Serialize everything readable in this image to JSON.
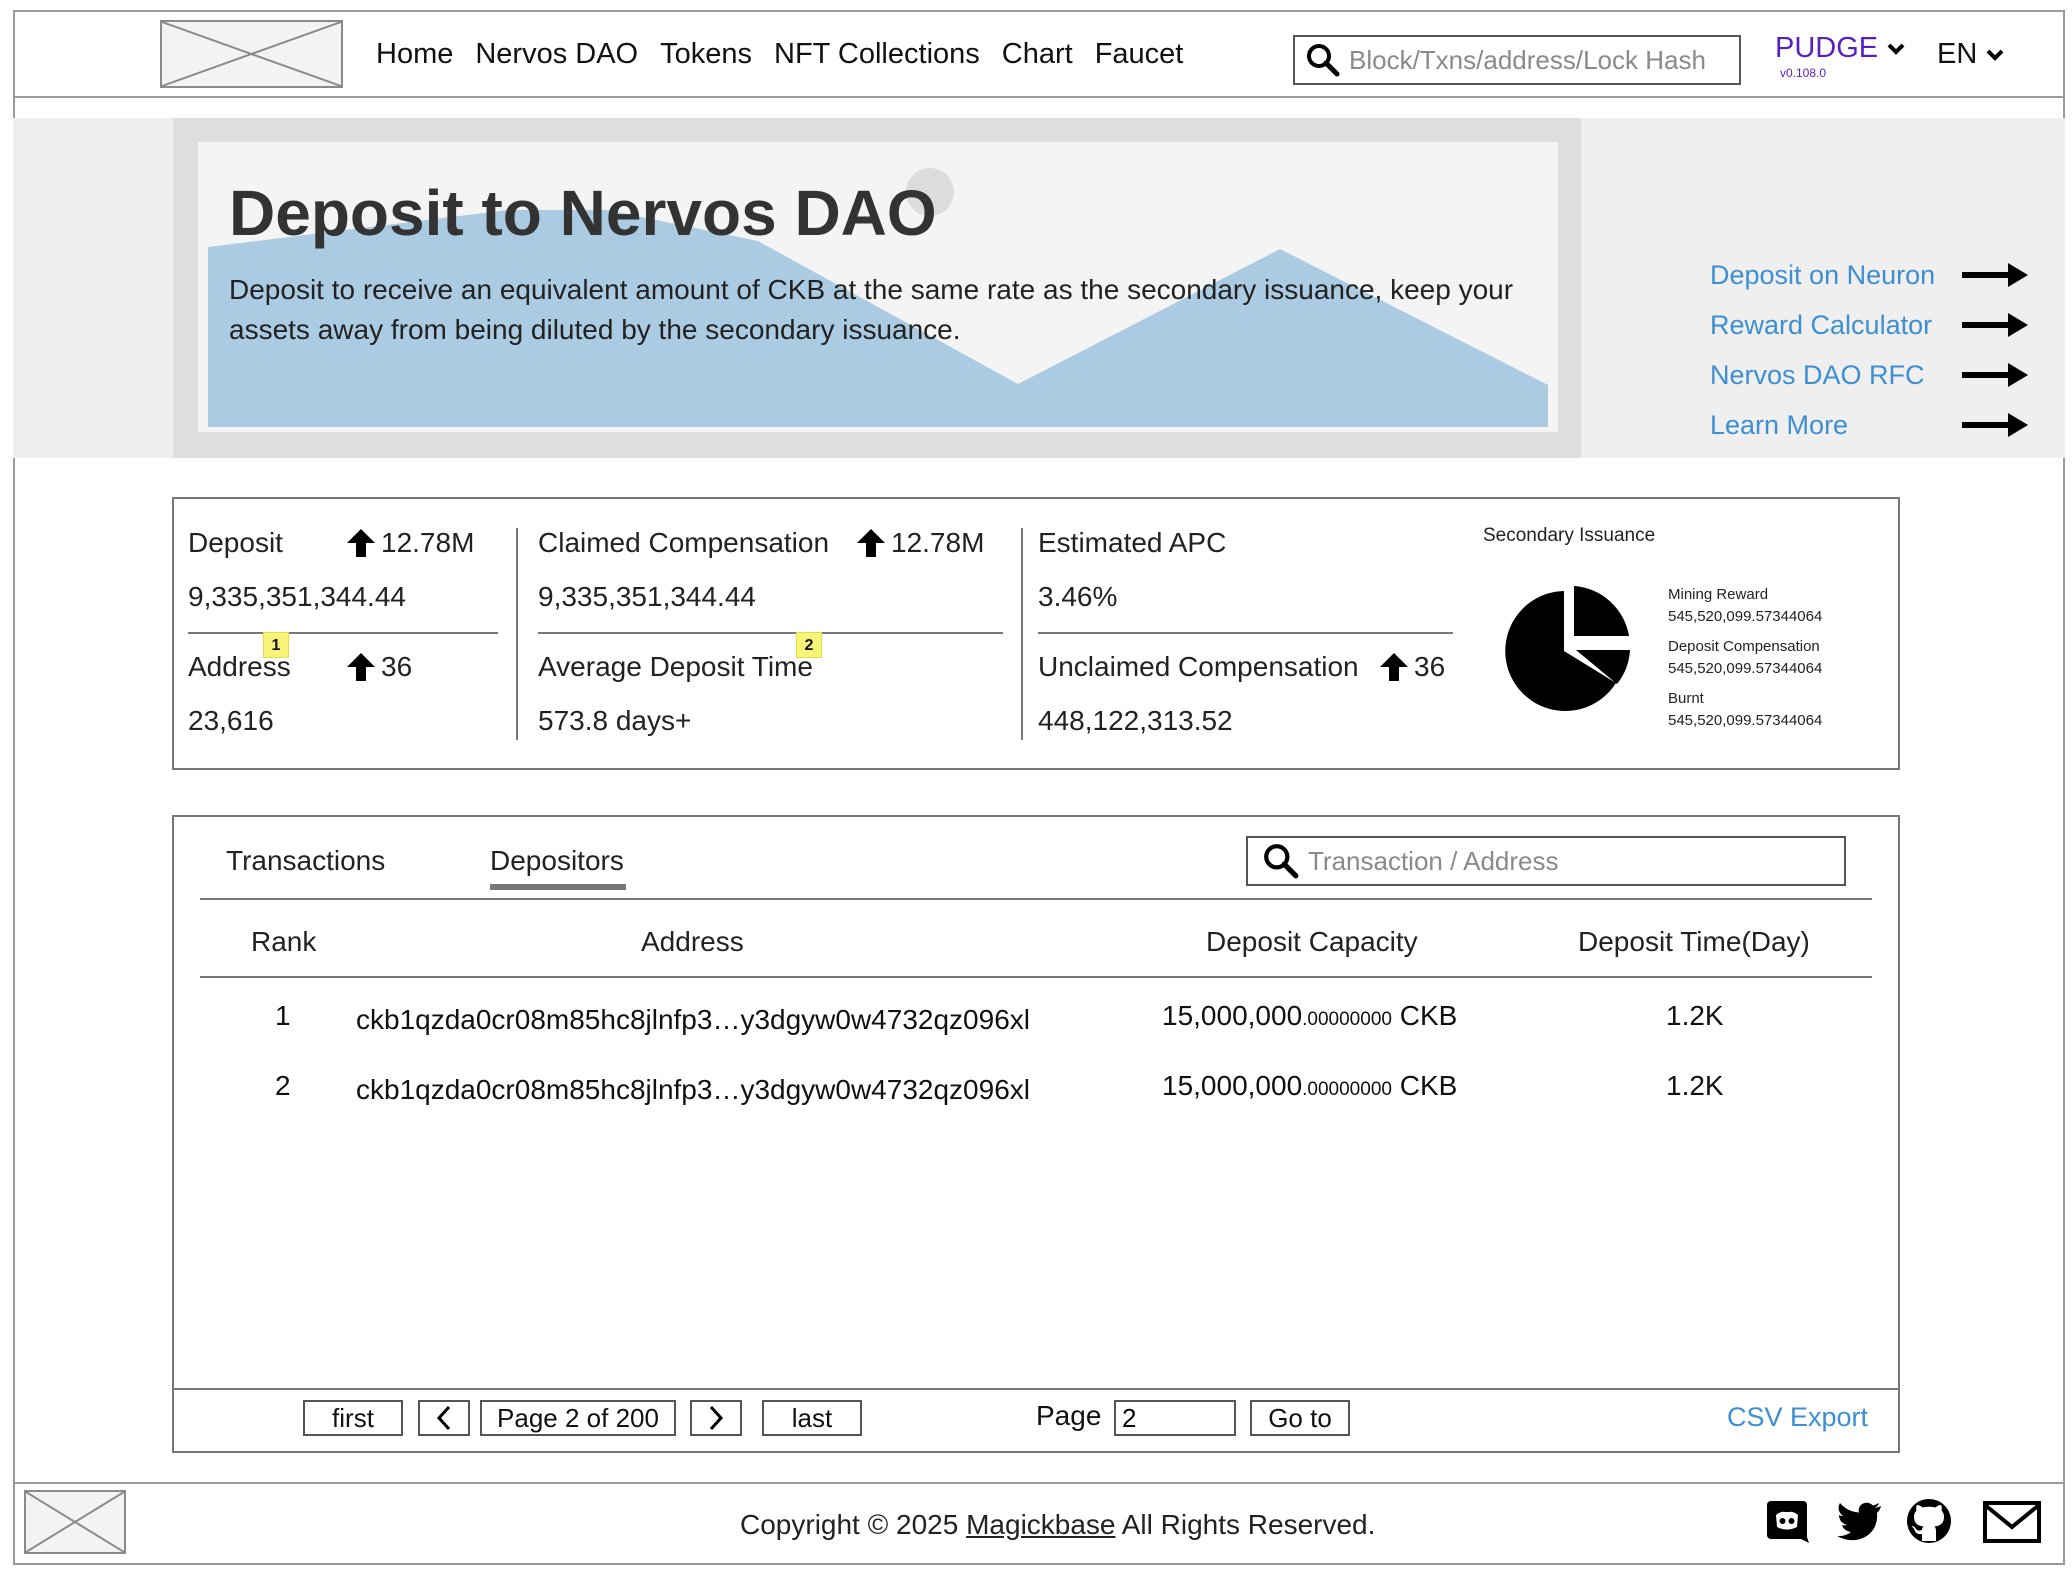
{
  "header": {
    "nav": [
      "Home",
      "Nervos DAO",
      "Tokens",
      "NFT Collections",
      "Chart",
      "Faucet"
    ],
    "search_placeholder": "Block/Txns/address/Lock Hash",
    "network": "PUDGE",
    "version": "v0.108.0",
    "language": "EN"
  },
  "hero": {
    "title": "Deposit to Nervos DAO",
    "description": "Deposit to receive an equivalent amount of CKB at the same rate as the secondary issuance, keep your assets away from being diluted by the secondary issuance.",
    "links": [
      "Deposit on Neuron",
      "Reward Calculator",
      "Nervos DAO RFC",
      "Learn More"
    ]
  },
  "stats": {
    "deposit": {
      "label": "Deposit",
      "delta": "12.78M",
      "value": "9,335,351,344.44"
    },
    "claimed": {
      "label": "Claimed Compensation",
      "delta": "12.78M",
      "value": "9,335,351,344.44"
    },
    "apc": {
      "label": "Estimated APC",
      "value": "3.46%"
    },
    "address": {
      "label": "Address",
      "delta": "36",
      "value": "23,616",
      "badge": "1"
    },
    "avg_time": {
      "label": "Average Deposit Time",
      "value": "573.8 days+",
      "badge": "2"
    },
    "unclaimed": {
      "label": "Unclaimed Compensation",
      "delta": "36",
      "value": "448,122,313.52"
    },
    "secondary": {
      "title": "Secondary Issuance",
      "items": [
        {
          "name": "Mining Reward",
          "value": "545,520,099.57344064"
        },
        {
          "name": "Deposit Compensation",
          "value": "545,520,099.57344064"
        },
        {
          "name": "Burnt",
          "value": "545,520,099.57344064"
        }
      ]
    }
  },
  "table": {
    "tabs": [
      "Transactions",
      "Depositors"
    ],
    "search_placeholder": "Transaction / Address",
    "headers": [
      "Rank",
      "Address",
      "Deposit Capacity",
      "Deposit Time(Day)"
    ],
    "rows": [
      {
        "rank": "1",
        "address": "ckb1qzda0cr08m85hc8jlnfp3…y3dgyw0w4732qz096xl",
        "cap_int": "15,000,000",
        "cap_dec": ".00000000",
        "unit": "CKB",
        "time": "1.2K"
      },
      {
        "rank": "2",
        "address": "ckb1qzda0cr08m85hc8jlnfp3…y3dgyw0w4732qz096xl",
        "cap_int": "15,000,000",
        "cap_dec": ".00000000",
        "unit": "CKB",
        "time": "1.2K"
      }
    ]
  },
  "pagination": {
    "first": "first",
    "page_info": "Page 2 of 200",
    "last": "last",
    "page_label": "Page",
    "page_value": "2",
    "go": "Go to",
    "csv": "CSV Export"
  },
  "footer": {
    "copy_prefix": "Copyright © 2025",
    "company": "Magickbase",
    "copy_suffix": "All Rights Reserved."
  }
}
